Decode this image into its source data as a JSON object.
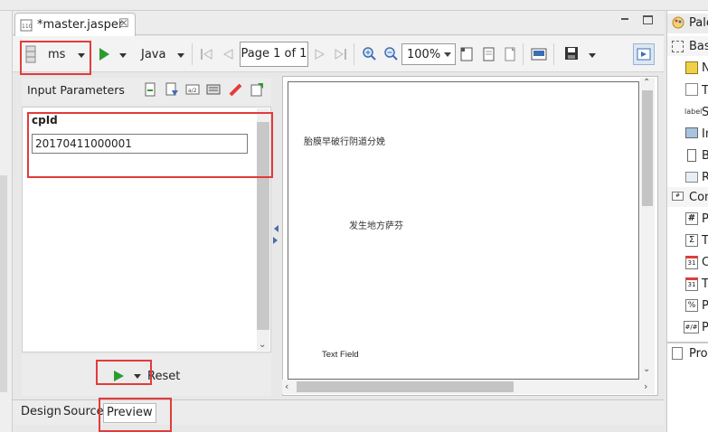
{
  "editor_tab": {
    "title": "*master.jasper",
    "close": "☒"
  },
  "toolbar": {
    "datasource": "ms",
    "language": "Java",
    "page_indicator": "Page 1 of 1",
    "zoom": "100%"
  },
  "input_parameters": {
    "title": "Input Parameters",
    "param_label": "cpId",
    "param_value": "20170411000001",
    "reset_label": "Reset"
  },
  "preview": {
    "text1": "胎膜早破行阴道分娩",
    "text2": "发生地方萨芬",
    "text3": "Text Field"
  },
  "bottom_tabs": [
    "Design",
    "Source",
    "Preview"
  ],
  "right_panel": {
    "palette_title": "Pale",
    "basic_section": "Bas",
    "basic_items": [
      "N",
      "T",
      "S",
      "In",
      "B",
      "R"
    ],
    "composite_section": "Con",
    "composite_items": [
      "P",
      "T",
      "C",
      "T",
      "P",
      "P"
    ],
    "properties_title": "Pro"
  },
  "colors": {
    "highlight": "#e23b3b",
    "run_green": "#2e9b2e",
    "accent_blue": "#3a6fb5"
  }
}
